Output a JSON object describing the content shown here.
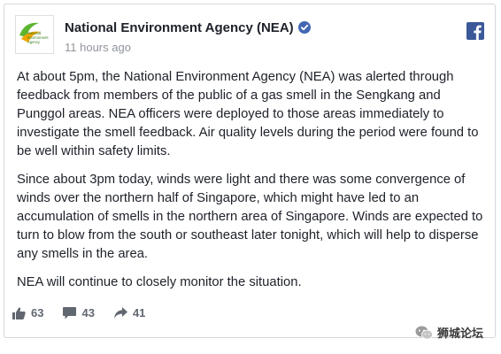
{
  "post": {
    "page_name": "National Environment Agency (NEA)",
    "timestamp": "11 hours ago",
    "paragraphs": [
      "At about 5pm, the National Environment Agency (NEA) was alerted through feedback from members of the public of a gas smell in the Sengkang and Punggol areas. NEA officers were deployed to those areas immediately to investigate the smell feedback. Air quality levels during the period were found to be well within safety limits.",
      "Since about 3pm today, winds were light and there was some convergence of winds over the northern half of Singapore, which might have led to an accumulation of smells in the northern area of Singapore. Winds are expected to turn to blow from the south or southeast later tonight, which will help to disperse any smells in the area.",
      "NEA will continue to closely monitor the situation."
    ],
    "likes": "63",
    "comments": "43",
    "shares": "41"
  },
  "avatar_logo": {
    "line1": "National",
    "line2": "Environment",
    "line3": "Agency"
  },
  "watermark": {
    "text": "狮城论坛"
  },
  "colors": {
    "facebook_blue": "#3b5998",
    "verified_blue": "#4267b2",
    "meta_gray": "#90949c",
    "action_gray": "#616770",
    "nea_green": "#5cb531"
  },
  "icons": [
    "verified-badge-icon",
    "facebook-logo-icon",
    "like-icon",
    "comment-icon",
    "share-icon",
    "wechat-icon"
  ]
}
